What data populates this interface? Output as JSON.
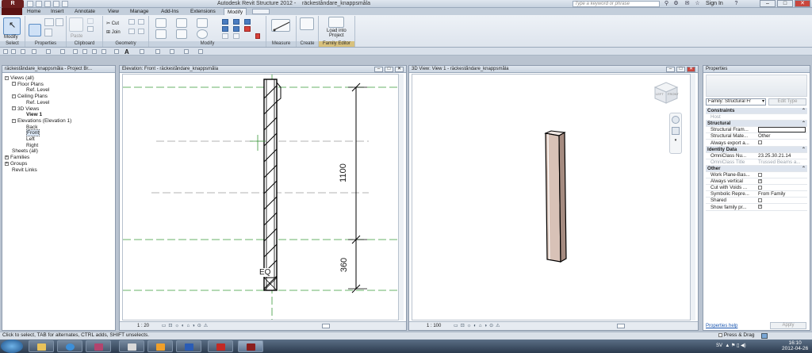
{
  "window": {
    "app_title": "Autodesk Revit Structure 2012 -",
    "doc_title": "räckeståndare_knappsmåla",
    "search_placeholder": "Type a keyword or phrase",
    "sign_in": "Sign In"
  },
  "ribbon": {
    "tabs": [
      "Home",
      "Insert",
      "Annotate",
      "View",
      "Manage",
      "Add-Ins",
      "Extensions",
      "Modify"
    ],
    "active_tab": "Modify",
    "groups": {
      "select": "Select",
      "properties": "Properties",
      "clipboard": "Clipboard",
      "geometry": "Geometry",
      "modify": "Modify",
      "measure": "Measure",
      "create": "Create",
      "family_editor": "Family Editor"
    },
    "buttons": {
      "modify": "Modify",
      "paste": "Paste",
      "cut": "Cut",
      "join": "Join",
      "load_into_project_l1": "Load into",
      "load_into_project_l2": "Project"
    }
  },
  "project_browser": {
    "title": "räckeståndare_knappsmåla - Project Br...",
    "items": [
      {
        "label": "Views (all)",
        "level": 0,
        "toggle": "-"
      },
      {
        "label": "Floor Plans",
        "level": 1,
        "toggle": "-"
      },
      {
        "label": "Ref. Level",
        "level": 2,
        "toggle": ""
      },
      {
        "label": "Ceiling Plans",
        "level": 1,
        "toggle": "-"
      },
      {
        "label": "Ref. Level",
        "level": 2,
        "toggle": ""
      },
      {
        "label": "3D Views",
        "level": 1,
        "toggle": "-"
      },
      {
        "label": "View 1",
        "level": 2,
        "toggle": "",
        "bold": true
      },
      {
        "label": "Elevations (Elevation 1)",
        "level": 1,
        "toggle": "-"
      },
      {
        "label": "Back",
        "level": 2,
        "toggle": ""
      },
      {
        "label": "Front",
        "level": 2,
        "toggle": "",
        "selected": true
      },
      {
        "label": "Left",
        "level": 2,
        "toggle": ""
      },
      {
        "label": "Right",
        "level": 2,
        "toggle": ""
      },
      {
        "label": "Sheets (all)",
        "level": 0,
        "toggle": ""
      },
      {
        "label": "Families",
        "level": 0,
        "toggle": "+"
      },
      {
        "label": "Groups",
        "level": 0,
        "toggle": "+"
      },
      {
        "label": "Revit Links",
        "level": 0,
        "toggle": ""
      }
    ]
  },
  "elevation_view": {
    "title": "Elevation: Front - räckeståndare_knappsmåla",
    "scale": "1 : 20",
    "dim_upper": "1100",
    "dim_lower": "360",
    "eq_label": "EQ"
  },
  "view_3d": {
    "title": "3D View: View 1 - räckeståndare_knappsmåla",
    "scale": "1 : 100",
    "cube_left": "LEFT",
    "cube_front": "FRONT"
  },
  "properties": {
    "title": "Properties",
    "family_selector": "Family: Structural Fr",
    "edit_type": "Edit Type",
    "rows": [
      {
        "type": "cat",
        "key": "Constraints"
      },
      {
        "type": "row",
        "key": "Host",
        "value": "",
        "grey": true
      },
      {
        "type": "cat",
        "key": "Structural"
      },
      {
        "type": "row",
        "key": "Structural Fram...",
        "value": "",
        "input": true
      },
      {
        "type": "row",
        "key": "Structural Mate...",
        "value": "Other"
      },
      {
        "type": "row",
        "key": "Always export a...",
        "value": "",
        "check": false
      },
      {
        "type": "cat",
        "key": "Identity Data"
      },
      {
        "type": "row",
        "key": "OmniClass Nu...",
        "value": "23.25.30.21.14"
      },
      {
        "type": "row",
        "key": "OmniClass Title",
        "value": "Trussed Beams a...",
        "grey": true
      },
      {
        "type": "cat",
        "key": "Other"
      },
      {
        "type": "row",
        "key": "Work Plane-Bas...",
        "value": "",
        "check": false
      },
      {
        "type": "row",
        "key": "Always vertical",
        "value": "",
        "check": true
      },
      {
        "type": "row",
        "key": "Cut with Voids ...",
        "value": "",
        "check": false
      },
      {
        "type": "row",
        "key": "Symbolic Repre...",
        "value": "From Family"
      },
      {
        "type": "row",
        "key": "Shared",
        "value": "",
        "check": false
      },
      {
        "type": "row",
        "key": "Show family pr...",
        "value": "",
        "check": true
      }
    ],
    "help_link": "Properties help",
    "apply": "Apply"
  },
  "status": {
    "text": "Click to select, TAB for alternates, CTRL adds, SHIFT unselects.",
    "press_drag": "Press & Drag"
  },
  "taskbar": {
    "lang": "SV",
    "time": "16:10",
    "date": "2012-04-26"
  }
}
